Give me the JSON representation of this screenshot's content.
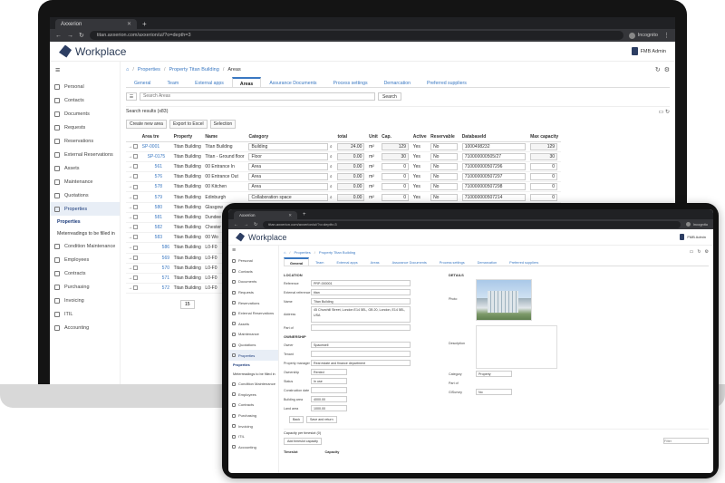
{
  "browser": {
    "tab_title": "Axxerion",
    "new_tab": "+",
    "url": "titan.axxerion.com/axxerion/ui/?o=depth=3",
    "profile": "Incognito"
  },
  "app": {
    "logo_text": "Workplace",
    "user_name": "FMB Admin"
  },
  "sidebar": {
    "items": [
      "Personal",
      "Contacts",
      "Documents",
      "Requests",
      "Reservations",
      "External Reservations",
      "Assets",
      "Maintenance",
      "Quotations",
      "Properties"
    ],
    "sub_head": "Properties",
    "sub_items": [
      "Meterreadings to be filled in"
    ],
    "items_after": [
      "Condition Maintenance",
      "Employees",
      "Contracts",
      "Purchasing",
      "Invoicing",
      "ITIL",
      "Accounting"
    ]
  },
  "laptop": {
    "breadcrumb": [
      "Properties",
      "Property Titan Building",
      "Areas"
    ],
    "tabs": [
      "General",
      "Team",
      "External apps",
      "Areas",
      "Assurance Documents",
      "Process settings",
      "Demarcation",
      "Preferred suppliers"
    ],
    "active_tab": "Areas",
    "search_placeholder": "Search Areas",
    "search_button": "Search",
    "results_label": "Search results (x83)",
    "actions": [
      "Create new area",
      "Export to Excel",
      "Selection"
    ],
    "columns": [
      "Area tre",
      "Property",
      "Name",
      "Category",
      "total",
      "Unit",
      "Cap.",
      "Active",
      "Reservable",
      "DatabaseId",
      "Max capacity"
    ],
    "rows": [
      {
        "tree": "SP-0001",
        "property": "Titan Building",
        "name": "Titan Building",
        "category": "Building",
        "total": "24.00",
        "unit": "m²",
        "cap": "129",
        "active": "Yes",
        "reservable": "No",
        "dbid": "1000498232",
        "max": "129"
      },
      {
        "tree": "SP-0175",
        "property": "Titan Building",
        "name": "Titan - Ground floor",
        "category": "Floor",
        "total": "0.00",
        "unit": "m²",
        "cap": "30",
        "active": "Yes",
        "reservable": "No",
        "dbid": "710000000505/27",
        "max": "30"
      },
      {
        "tree": "561",
        "property": "Titan Building",
        "name": "00 Entrance In",
        "category": "Area",
        "total": "0.00",
        "unit": "m²",
        "cap": "0",
        "active": "Yes",
        "reservable": "No",
        "dbid": "710000000507296",
        "max": "0"
      },
      {
        "tree": "576",
        "property": "Titan Building",
        "name": "00 Entrance Out",
        "category": "Area",
        "total": "0.00",
        "unit": "m²",
        "cap": "0",
        "active": "Yes",
        "reservable": "No",
        "dbid": "710000000507297",
        "max": "0"
      },
      {
        "tree": "578",
        "property": "Titan Building",
        "name": "00 Kitchen",
        "category": "Area",
        "total": "0.00",
        "unit": "m²",
        "cap": "0",
        "active": "Yes",
        "reservable": "No",
        "dbid": "710000000507298",
        "max": "0"
      },
      {
        "tree": "579",
        "property": "Titan Building",
        "name": "Edinburgh",
        "category": "Collaboration space",
        "total": "0.00",
        "unit": "m²",
        "cap": "0",
        "active": "Yes",
        "reservable": "No",
        "dbid": "710000000507214",
        "max": "0"
      },
      {
        "tree": "580",
        "property": "Titan Building",
        "name": "Glasgow",
        "category": "",
        "total": "",
        "unit": "",
        "cap": "",
        "active": "",
        "reservable": "",
        "dbid": "",
        "max": ""
      },
      {
        "tree": "581",
        "property": "Titan Building",
        "name": "Dundee",
        "category": "",
        "total": "",
        "unit": "",
        "cap": "",
        "active": "",
        "reservable": "",
        "dbid": "",
        "max": ""
      },
      {
        "tree": "582",
        "property": "Titan Building",
        "name": "Chester",
        "category": "",
        "total": "",
        "unit": "",
        "cap": "",
        "active": "",
        "reservable": "",
        "dbid": "",
        "max": ""
      },
      {
        "tree": "583",
        "property": "Titan Building",
        "name": "00 Wo",
        "category": "",
        "total": "",
        "unit": "",
        "cap": "",
        "active": "",
        "reservable": "",
        "dbid": "",
        "max": ""
      },
      {
        "tree": "586",
        "property": "Titan Building",
        "name": "L0-F0",
        "category": "",
        "total": "",
        "unit": "",
        "cap": "",
        "active": "",
        "reservable": "",
        "dbid": "",
        "max": ""
      },
      {
        "tree": "569",
        "property": "Titan Building",
        "name": "L0-F0",
        "category": "",
        "total": "",
        "unit": "",
        "cap": "",
        "active": "",
        "reservable": "",
        "dbid": "",
        "max": ""
      },
      {
        "tree": "570",
        "property": "Titan Building",
        "name": "L0-F0",
        "category": "",
        "total": "",
        "unit": "",
        "cap": "",
        "active": "",
        "reservable": "",
        "dbid": "",
        "max": ""
      },
      {
        "tree": "571",
        "property": "Titan Building",
        "name": "L0-F0",
        "category": "",
        "total": "",
        "unit": "",
        "cap": "",
        "active": "",
        "reservable": "",
        "dbid": "",
        "max": ""
      },
      {
        "tree": "572",
        "property": "Titan Building",
        "name": "L0-F0",
        "category": "",
        "total": "",
        "unit": "",
        "cap": "",
        "active": "",
        "reservable": "",
        "dbid": "",
        "max": ""
      }
    ],
    "pager": "15"
  },
  "tablet": {
    "breadcrumb": [
      "Properties",
      "Property Titan Building"
    ],
    "tabs": [
      "General",
      "Team",
      "External apps",
      "Areas",
      "Assurance Documents",
      "Process settings",
      "Demarcation",
      "Preferred suppliers"
    ],
    "active_tab": "General",
    "location_title": "LOCATION",
    "fields": [
      {
        "label": "Reference",
        "value": "PRP-000001"
      },
      {
        "label": "External reference",
        "value": "titan"
      },
      {
        "label": "Name",
        "value": "Titan Building"
      },
      {
        "label": "Address",
        "value": "45 Churchill Street, London E14 5EL, GB 20, London, E14 5EL, USA"
      },
      {
        "label": "Part of",
        "value": ""
      }
    ],
    "ownership_title": "OWNERSHIP",
    "owner_fields": [
      {
        "label": "Owner",
        "value": "Spacewell"
      },
      {
        "label": "Tenant",
        "value": ""
      },
      {
        "label": "Property manager",
        "value": "Real estate and finance department"
      },
      {
        "label": "Ownership",
        "value": "Rented"
      },
      {
        "label": "Status",
        "value": "In use"
      },
      {
        "label": "Construction date",
        "value": ""
      },
      {
        "label": "Building area",
        "value": "4000.00"
      },
      {
        "label": "Land area",
        "value": "1000.00"
      }
    ],
    "details_title": "DETAILS",
    "photo_label": "Photo",
    "description_label": "Description",
    "category_label": "Category",
    "category_value": "Property",
    "part_of_label": "Part of",
    "gis_label": "GISurvey",
    "gis_value": "No",
    "buttons": [
      "Back",
      "Save and return"
    ],
    "capacity_title": "Capacity per timeslot (0)",
    "add_capacity": "Add timeslot capacity",
    "filter_placeholder": "Filter",
    "cap_columns": [
      "Timeslot",
      "Capacity"
    ]
  }
}
